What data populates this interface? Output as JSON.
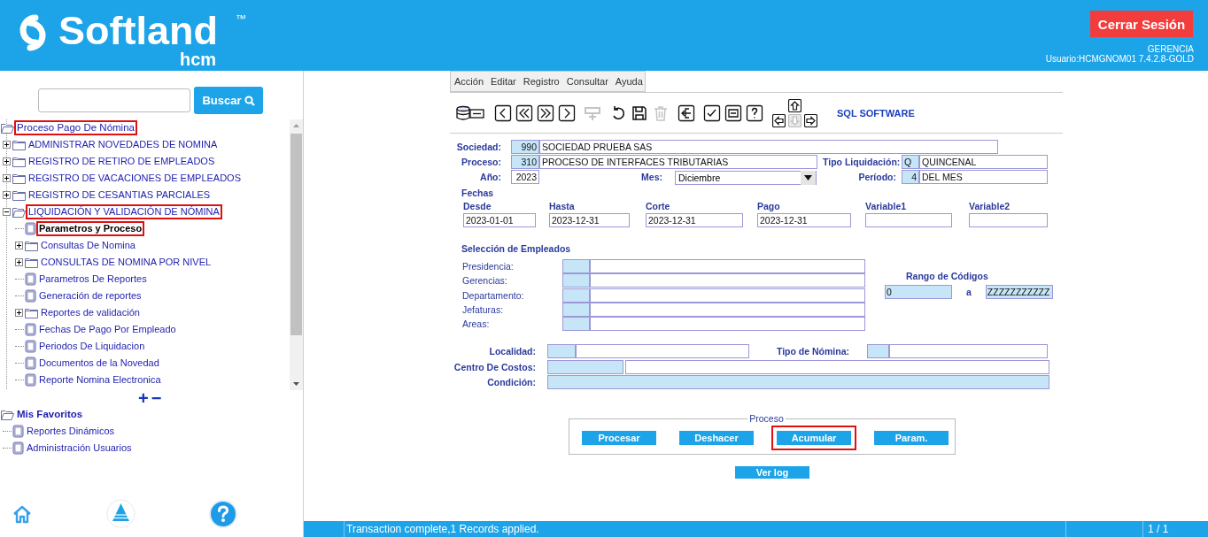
{
  "header": {
    "logo_word": "Softland",
    "trademark": "™",
    "logo_sub": "hcm",
    "logout_button": "Cerrar Sesión",
    "role": "GERENCIA",
    "user": "Usuario:HCMGNOM01 7.4.2.8-GOLD"
  },
  "sidebar": {
    "search_button": "Buscar",
    "tree": {
      "kind": "folder",
      "label": "Proceso Pago De Nómina",
      "expanded": true,
      "selected": false,
      "highlighted": true,
      "children": [
        {
          "kind": "folder",
          "label": "ADMINISTRAR NOVEDADES DE NOMINA",
          "expanded": false,
          "selected": false,
          "highlighted": false
        },
        {
          "kind": "folder",
          "label": "REGISTRO DE RETIRO DE EMPLEADOS",
          "expanded": false,
          "selected": false,
          "highlighted": false
        },
        {
          "kind": "folder",
          "label": "REGISTRO DE VACACIONES DE EMPLEADOS",
          "expanded": false,
          "selected": false,
          "highlighted": false
        },
        {
          "kind": "folder",
          "label": "REGISTRO DE CESANTIAS PARCIALES",
          "expanded": false,
          "selected": false,
          "highlighted": false
        },
        {
          "kind": "folder",
          "label": "LIQUIDACIÓN Y VALIDACIÓN DE NÓMINA",
          "expanded": true,
          "selected": false,
          "highlighted": true,
          "children": [
            {
              "kind": "document",
              "label": "Parametros y Proceso",
              "selected": true,
              "highlighted": true
            },
            {
              "kind": "folder",
              "label": "Consultas De Nomina",
              "expanded": false,
              "selected": false,
              "highlighted": false
            },
            {
              "kind": "folder",
              "label": "CONSULTAS DE NOMINA POR NIVEL",
              "expanded": false,
              "selected": false,
              "highlighted": false
            },
            {
              "kind": "document",
              "label": "Parametros De Reportes",
              "selected": false,
              "highlighted": false
            },
            {
              "kind": "document",
              "label": "Generación de reportes",
              "selected": false,
              "highlighted": false
            },
            {
              "kind": "folder",
              "label": "Reportes de validación",
              "expanded": false,
              "selected": false,
              "highlighted": false
            },
            {
              "kind": "document",
              "label": "Fechas De Pago Por Empleado",
              "selected": false,
              "highlighted": false
            },
            {
              "kind": "document",
              "label": "Periodos De Liquidacion",
              "selected": false,
              "highlighted": false
            },
            {
              "kind": "document",
              "label": "Documentos de la Novedad",
              "selected": false,
              "highlighted": false
            },
            {
              "kind": "document",
              "label": "Reporte Nomina Electronica",
              "selected": false,
              "highlighted": false
            }
          ]
        }
      ]
    },
    "expand_all": "+",
    "collapse_all": "−",
    "favorites": {
      "kind": "folder",
      "label": "Mis Favoritos",
      "expanded": true,
      "selected": false,
      "highlighted": false,
      "children": [
        {
          "kind": "document",
          "label": "Reportes Dinámicos",
          "selected": false,
          "highlighted": false
        },
        {
          "kind": "document",
          "label": "Administración Usuarios",
          "selected": false,
          "highlighted": false
        }
      ]
    }
  },
  "menu": [
    "Acción",
    "Editar",
    "Registro",
    "Consultar",
    "Ayuda"
  ],
  "toolbar": {
    "buttons": [
      {
        "kind": "database",
        "disabled": false
      },
      {
        "kind": "previous",
        "disabled": false
      },
      {
        "kind": "first",
        "disabled": false
      },
      {
        "kind": "last",
        "disabled": false
      },
      {
        "kind": "next",
        "disabled": false
      },
      {
        "kind": "insert",
        "disabled": true
      },
      {
        "kind": "undo",
        "disabled": false
      },
      {
        "kind": "save",
        "disabled": false
      },
      {
        "kind": "delete",
        "disabled": true
      },
      {
        "kind": "exit",
        "disabled": false
      },
      {
        "kind": "checklist",
        "disabled": false
      },
      {
        "kind": "excel",
        "disabled": false
      },
      {
        "kind": "help",
        "disabled": false
      }
    ],
    "arrows": [
      {
        "kind": "up",
        "disabled": false
      },
      {
        "kind": "left",
        "disabled": false
      },
      {
        "kind": "down",
        "disabled": true
      },
      {
        "kind": "right",
        "disabled": false
      }
    ],
    "brand": "SQL SOFTWARE"
  },
  "form": {
    "sociedad": {
      "label": "Sociedad:",
      "code": "990",
      "name": "SOCIEDAD  PRUEBA SAS"
    },
    "proceso": {
      "label": "Proceso:",
      "code": "310",
      "name": "PROCESO DE INTERFACES TRIBUTARIAS"
    },
    "tipo_liquidacion": {
      "label": "Tipo Liquidación:",
      "code": "Q",
      "name": "QUINCENAL"
    },
    "anio": {
      "label": "Año:",
      "value": "2023"
    },
    "mes": {
      "label": "Mes:",
      "value": "Diciembre"
    },
    "periodo": {
      "label": "Período:",
      "code": "4",
      "name": "DEL MES"
    },
    "fechas": {
      "title": "Fechas",
      "fields": [
        {
          "label": "Desde",
          "value": "2023-01-01"
        },
        {
          "label": "Hasta",
          "value": "2023-12-31"
        },
        {
          "label": "Corte",
          "value": "2023-12-31"
        },
        {
          "label": "Pago",
          "value": "2023-12-31"
        },
        {
          "label": "Variable1"
        },
        {
          "label": "Variable2"
        }
      ]
    },
    "seleccion": {
      "title": "Selección de Empleados",
      "rows": [
        {
          "label": "Presidencia:"
        },
        {
          "label": "Gerencias:"
        },
        {
          "label": "Departamento:"
        },
        {
          "label": "Jefaturas:"
        },
        {
          "label": "Areas:"
        }
      ]
    },
    "rango": {
      "title": "Rango de Códigos",
      "from": "0",
      "separator": "a",
      "to": "ZZZZZZZZZZZ"
    },
    "localidad": {
      "label": "Localidad:"
    },
    "tipo_nomina": {
      "label": "Tipo de Nómina:"
    },
    "centro_costos": {
      "label": "Centro De Costos:"
    },
    "condicion": {
      "label": "Condición:"
    }
  },
  "process": {
    "title": "Proceso",
    "buttons": [
      {
        "label": "Procesar",
        "highlighted": false
      },
      {
        "label": "Deshacer",
        "highlighted": false
      },
      {
        "label": "Acumular",
        "highlighted": true
      },
      {
        "label": "Param.",
        "highlighted": false
      }
    ],
    "log_button": "Ver log"
  },
  "status_bar": {
    "message": "Transaction complete,1 Records applied.",
    "page": "1 / 1"
  }
}
